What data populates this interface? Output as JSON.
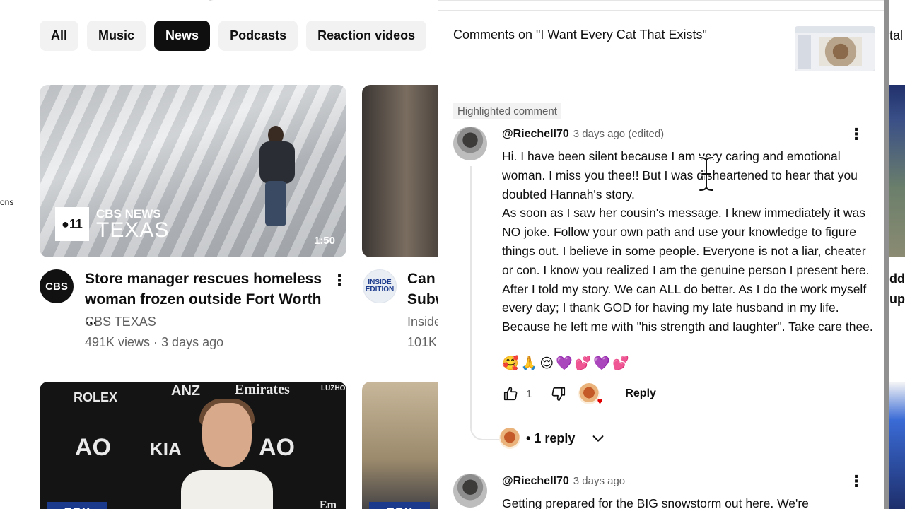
{
  "side_fragment": "ons",
  "chips": [
    "All",
    "Music",
    "News",
    "Podcasts",
    "Reaction videos"
  ],
  "active_chip": "News",
  "videos": [
    {
      "title": "Store manager rescues homeless woman frozen outside Fort Worth ...",
      "channel": "CBS TEXAS",
      "meta": "491K views · 3 days ago",
      "duration": "1:50",
      "thumb_logo_news": "CBS NEWS",
      "thumb_logo_region": "TEXAS",
      "avatar_text": "CBS"
    },
    {
      "title": "Can ... Subw",
      "title_line1": "Can ...",
      "title_line2": "Subw",
      "channel": "Inside",
      "meta": "101K",
      "avatar_text": "INSIDE EDITION"
    }
  ],
  "bottom_thumbs": {
    "sponsors": [
      "ROLEX",
      "ANZ",
      "Emirates",
      "LUZHOU",
      "AO",
      "KIA",
      "AO",
      "Em"
    ],
    "network_logo": "FOX"
  },
  "right_strip_fragments": [
    "tal",
    "dd",
    "up"
  ],
  "comments_panel": {
    "title": "Comments on \"I Want Every Cat That Exists\"",
    "highlighted_label": "Highlighted comment",
    "comments": [
      {
        "handle": "@Riechell70",
        "time": "3 days ago (edited)",
        "body": "Hi.  I have been silent because I am very caring and emotional woman. I miss you thee!! But I was disheartened to hear that you doubted Hannah's story.\nAs soon as I saw her cousin's message.  I knew immediately it was NO joke. Follow your own path and use your knowledge to figure things out. I believe in  some people.  Everyone is not a liar, cheater or con. I know you realized I am the genuine person I present here. After I told my story.  We can ALL do better.  As I do the work myself every day; I thank GOD for having my late husband in my life.  Because he left me with \"his strength and laughter\". Take care thee.",
        "emojis": "🥰🙏😌💜💕💜💕",
        "likes": "1",
        "reply_label": "Reply",
        "replies_label": "1 reply"
      },
      {
        "handle": "@Riechell70",
        "time": "3 days ago",
        "body": "Getting prepared for the BIG snowstorm out here. We're"
      }
    ]
  }
}
